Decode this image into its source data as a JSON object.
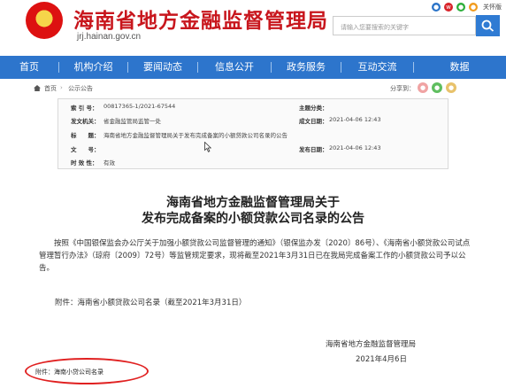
{
  "header": {
    "site_title": "海南省地方金融监督管理局",
    "site_url": "jrj.hainan.gov.cn",
    "top_right_label": "关怀版",
    "search": {
      "placeholder": "请输入您要搜索的关键字"
    }
  },
  "nav": {
    "items": [
      {
        "label": "首页"
      },
      {
        "label": "机构介绍"
      },
      {
        "label": "要闻动态"
      },
      {
        "label": "信息公开"
      },
      {
        "label": "政务服务"
      },
      {
        "label": "互动交流"
      },
      {
        "label": "数据"
      }
    ]
  },
  "breadcrumb": {
    "items": [
      "首页",
      "公示公告"
    ],
    "share_label": "分享到："
  },
  "info": {
    "index_label": "索 引 号：",
    "index_value": "00817365-1/2021-67544",
    "category_label": "主题分类：",
    "category_value": "",
    "issuer_label": "发文机关：",
    "issuer_value": "省金融监管局监管一处",
    "created_label": "成文日期：",
    "created_value": "2021-04-06 12:43",
    "title_label": "标　　题：",
    "title_value": "海南省地方金融监督管理局关于发布完成备案的小额贷款公司名录的公告",
    "docno_label": "文　　号：",
    "docno_value": "",
    "published_label": "发布日期：",
    "published_value": "2021-04-06 12:43",
    "validity_label": "时 效 性：",
    "validity_value": "有效"
  },
  "article": {
    "title_line1": "海南省地方金融监督管理局关于",
    "title_line2": "发布完成备案的小额贷款公司名录的公告",
    "body": "按照《中国银保监会办公厅关于加强小额贷款公司监督管理的通知》（银保监办发〔2020〕86号）、《海南省小额贷款公司试点管理暂行办法》（琼府〔2009〕72号）等监管规定要求，现将截至2021年3月31日已在我局完成备案工作的小额贷款公司予以公告。",
    "attachment_note": "附件：海南省小额贷款公司名录（截至2021年3月31日）",
    "signature_org": "海南省地方金融监督管理局",
    "signature_date": "2021年4月6日",
    "attachment_label": "附件：",
    "attachment_file": "海南小贷公司名录"
  },
  "colors": {
    "brand_red": "#c8161d",
    "nav_blue": "#2d75cc",
    "highlight_ring": "#e02020"
  }
}
